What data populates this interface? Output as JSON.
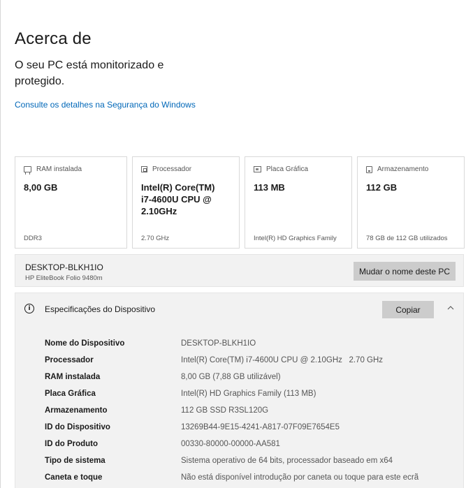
{
  "page": {
    "title": "Acerca de",
    "protection_text": "O seu PC está monitorizado e protegido.",
    "security_link": "Consulte os detalhes na Segurança do Windows"
  },
  "cards": [
    {
      "icon": "ram-icon",
      "label": "RAM instalada",
      "value": "8,00 GB",
      "footer": "DDR3"
    },
    {
      "icon": "processor-icon",
      "label": "Processador",
      "value": "Intel(R) Core(TM) i7-4600U CPU @ 2.10GHz",
      "footer": "2.70 GHz"
    },
    {
      "icon": "graphics-card-icon",
      "label": "Placa Gráfica",
      "value": "113 MB",
      "footer": "Intel(R) HD Graphics Family"
    },
    {
      "icon": "storage-icon",
      "label": "Armazenamento",
      "value": "112 GB",
      "footer": "78 GB de 112 GB utilizados"
    }
  ],
  "device": {
    "name": "DESKTOP-BLKH1IO",
    "model": "HP EliteBook Folio 9480m",
    "rename_label": "Mudar o nome deste PC"
  },
  "specs": {
    "title": "Especificações do Dispositivo",
    "copy_label": "Copiar",
    "rows": [
      {
        "label": "Nome do Dispositivo",
        "value": "DESKTOP-BLKH1IO"
      },
      {
        "label": "Processador",
        "value": "Intel(R) Core(TM) i7-4600U CPU @ 2.10GHz   2.70 GHz"
      },
      {
        "label": "RAM instalada",
        "value": "8,00 GB (7,88 GB utilizável)"
      },
      {
        "label": "Placa Gráfica",
        "value": "Intel(R) HD Graphics Family (113 MB)"
      },
      {
        "label": "Armazenamento",
        "value": "112 GB SSD R3SL120G"
      },
      {
        "label": "ID do Dispositivo",
        "value": "13269B44-9E15-4241-A817-07F09E7654E5"
      },
      {
        "label": "ID do Produto",
        "value": "00330-80000-00000-AA581"
      },
      {
        "label": "Tipo de sistema",
        "value": "Sistema operativo de 64 bits, processador baseado em x64"
      },
      {
        "label": "Caneta e toque",
        "value": "Não está disponível introdução por caneta ou toque para este ecrã"
      }
    ]
  },
  "colors": {
    "link": "#0067b8",
    "panel": "#f2f2f2",
    "button": "#cccccc"
  }
}
